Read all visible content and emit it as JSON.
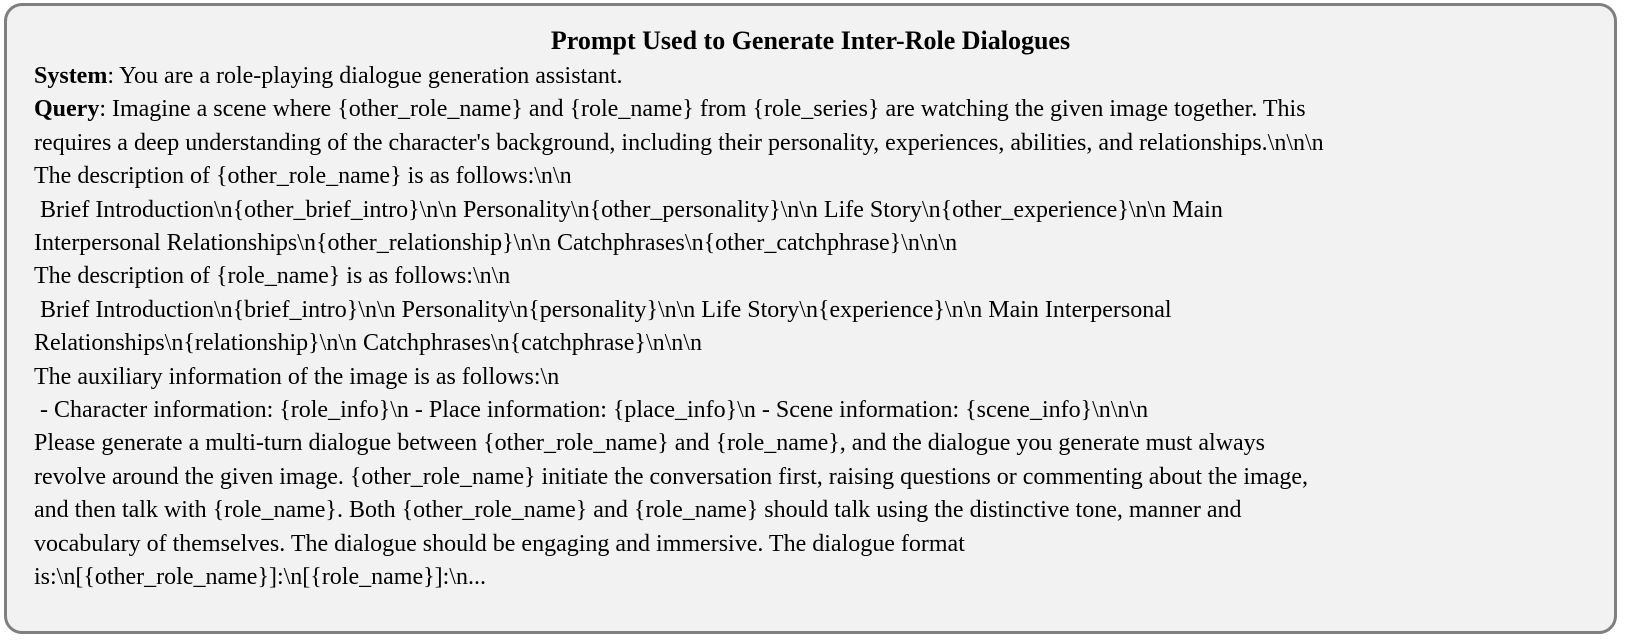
{
  "title": "Prompt Used to Generate Inter-Role Dialogues",
  "system": {
    "label": "System",
    "text": ": You are a role-playing dialogue generation assistant."
  },
  "query": {
    "label": "Query",
    "first_line": ": Imagine a scene where {other_role_name} and {role_name} from {role_series} are watching the given image together. This",
    "lines": [
      "requires a deep understanding of the character's background, including their personality, experiences, abilities, and relationships.\\n\\n\\n",
      "The description of {other_role_name} is as follows:\\n\\n",
      " Brief Introduction\\n{other_brief_intro}\\n\\n Personality\\n{other_personality}\\n\\n Life Story\\n{other_experience}\\n\\n Main",
      "Interpersonal Relationships\\n{other_relationship}\\n\\n Catchphrases\\n{other_catchphrase}\\n\\n\\n",
      "The description of {role_name} is as follows:\\n\\n",
      " Brief Introduction\\n{brief_intro}\\n\\n Personality\\n{personality}\\n\\n Life Story\\n{experience}\\n\\n Main Interpersonal",
      "Relationships\\n{relationship}\\n\\n Catchphrases\\n{catchphrase}\\n\\n\\n",
      "The auxiliary information of the image is as follows:\\n",
      " - Character information: {role_info}\\n - Place information: {place_info}\\n - Scene information: {scene_info}\\n\\n\\n",
      "Please generate a multi-turn dialogue between {other_role_name} and {role_name}, and the dialogue you generate must always",
      "revolve around the given image. {other_role_name} initiate the conversation first, raising questions or commenting about the image,",
      "and then talk with {role_name}. Both {other_role_name} and {role_name} should talk using the distinctive tone, manner and",
      "vocabulary of themselves. The dialogue should be engaging and immersive. The dialogue format",
      "is:\\n[{other_role_name}]:\\n[{role_name}]:\\n..."
    ]
  }
}
